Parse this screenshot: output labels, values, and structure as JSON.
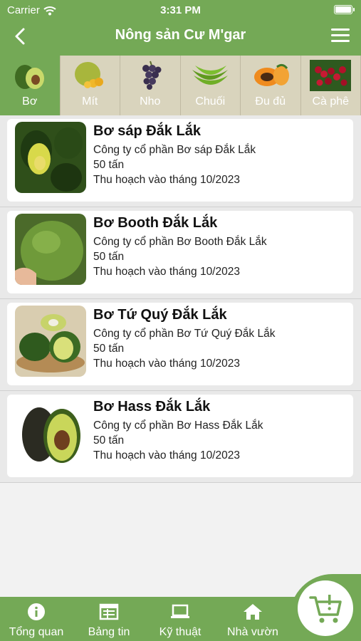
{
  "status": {
    "carrier": "Carrier",
    "time": "3:31 PM"
  },
  "nav": {
    "title": "Nông sản Cư M'gar"
  },
  "categories": [
    {
      "label": "Bơ",
      "active": true
    },
    {
      "label": "Mít",
      "active": false
    },
    {
      "label": "Nho",
      "active": false
    },
    {
      "label": "Chuối",
      "active": false
    },
    {
      "label": "Đu đủ",
      "active": false
    },
    {
      "label": "Cà phê",
      "active": false
    }
  ],
  "products": [
    {
      "name": "Bơ sáp Đắk Lắk",
      "company": "Công ty cổ phần Bơ sáp Đắk Lắk",
      "quantity": "50 tấn",
      "harvest": "Thu hoạch vào tháng 10/2023"
    },
    {
      "name": "Bơ Booth Đắk Lắk",
      "company": "Công ty cổ phần Bơ Booth Đắk Lắk",
      "quantity": "50 tấn",
      "harvest": "Thu hoạch vào tháng 10/2023"
    },
    {
      "name": "Bơ Tứ Quý Đắk Lắk",
      "company": "Công ty cổ phần Bơ Tứ Quý Đắk Lắk",
      "quantity": "50 tấn",
      "harvest": "Thu hoạch vào tháng 10/2023"
    },
    {
      "name": "Bơ Hass Đắk Lắk",
      "company": "Công ty cổ phần Bơ Hass Đắk Lắk",
      "quantity": "50 tấn",
      "harvest": "Thu hoạch vào tháng 10/2023"
    }
  ],
  "tabs": [
    {
      "label": "Tổng quan",
      "icon": "info-icon"
    },
    {
      "label": "Bảng tin",
      "icon": "newsfeed-icon"
    },
    {
      "label": "Kỹ thuật",
      "icon": "laptop-icon"
    },
    {
      "label": "Nhà vườn",
      "icon": "home-icon"
    }
  ],
  "cart": {
    "icon": "cart-icon"
  },
  "colors": {
    "primary": "#74a956",
    "category_bg": "#d9d4bd"
  }
}
